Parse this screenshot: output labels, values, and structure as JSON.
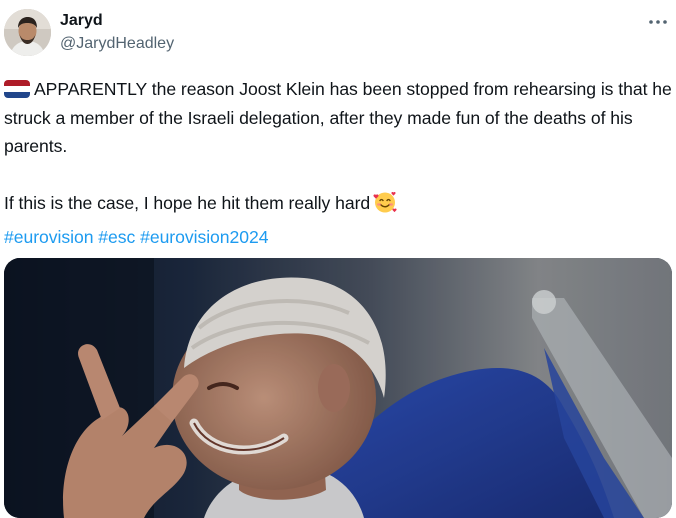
{
  "user": {
    "display_name": "Jaryd",
    "handle": "@JarydHeadley"
  },
  "more_icon": "more-horizontal-icon",
  "tweet": {
    "flag_icon": "netherlands-flag-icon",
    "line1": "APPARENTLY the reason Joost Klein has been stopped from rehearsing is that he struck a member of the Israeli delegation, after they made fun of the deaths of his parents.",
    "line2": "If this is the case, I hope he hit them really hard",
    "emoji_icon": "smiling-face-with-hearts-icon",
    "hashtags": [
      "#eurovision",
      "#esc",
      "#eurovision2024"
    ]
  },
  "colors": {
    "link": "#1d9bf0",
    "text": "#0f1419",
    "secondary": "#536471"
  }
}
